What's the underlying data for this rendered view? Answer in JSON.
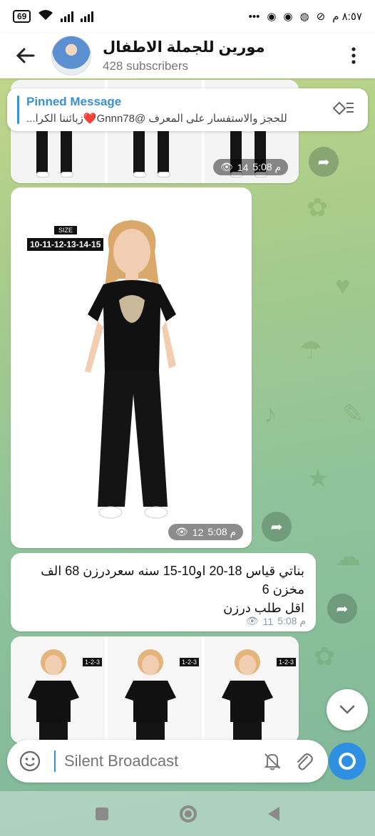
{
  "status_bar": {
    "time": "٨:٥٧ م",
    "battery": "69"
  },
  "header": {
    "title": "مورين للجملة الاطفال",
    "subscribers": "428 subscribers"
  },
  "pinned": {
    "title": "Pinned Message",
    "text": "للحجز والاستفسار على المعرف @Gnnn78❤️زبائننا الكرا..."
  },
  "messages": [
    {
      "views": "14",
      "time": "5:08 م"
    },
    {
      "size_header": "SIZE",
      "size_range": "10-11-12-13-14-15",
      "views": "12",
      "time": "5:08 م"
    },
    {
      "text_line1": "بناتي قياس 18-20 او10-15 سنه سعردرزن 68 الف",
      "text_line2": "مخزن 6",
      "text_line3": "اقل طلب درزن",
      "views": "11",
      "time": "5:08 م"
    },
    {
      "size_badge": "1-2-3"
    }
  ],
  "composer": {
    "placeholder": "Silent Broadcast"
  },
  "colors": {
    "accent": "#2f8fe0",
    "pinned_title": "#3a8fd6"
  }
}
